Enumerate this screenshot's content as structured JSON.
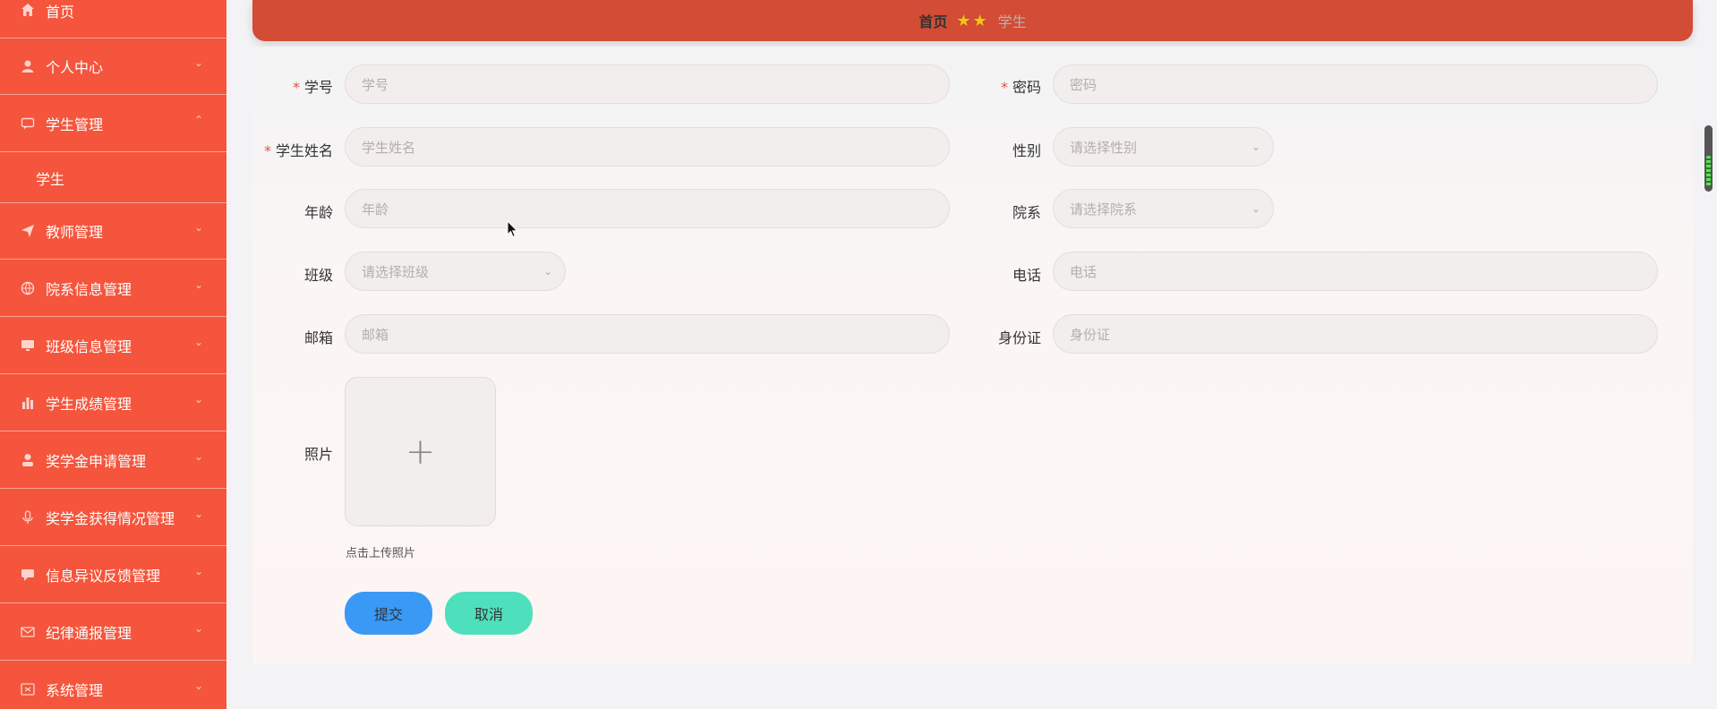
{
  "sidebar": {
    "home": "首页",
    "personal": "个人中心",
    "student_mgmt": "学生管理",
    "student_sub": "学生",
    "teacher_mgmt": "教师管理",
    "dept_mgmt": "院系信息管理",
    "class_mgmt": "班级信息管理",
    "score_mgmt": "学生成绩管理",
    "scholarship_apply": "奖学金申请管理",
    "scholarship_award": "奖学金获得情况管理",
    "feedback": "信息异议反馈管理",
    "discipline": "纪律通报管理",
    "system": "系统管理"
  },
  "breadcrumb": {
    "home": "首页",
    "stars": "★★",
    "current": "学生"
  },
  "form": {
    "student_no_label": "学号",
    "student_no_placeholder": "学号",
    "password_label": "密码",
    "password_placeholder": "密码",
    "name_label": "学生姓名",
    "name_placeholder": "学生姓名",
    "gender_label": "性别",
    "gender_placeholder": "请选择性别",
    "age_label": "年龄",
    "age_placeholder": "年龄",
    "dept_label": "院系",
    "dept_placeholder": "请选择院系",
    "class_label": "班级",
    "class_placeholder": "请选择班级",
    "phone_label": "电话",
    "phone_placeholder": "电话",
    "email_label": "邮箱",
    "email_placeholder": "邮箱",
    "idcard_label": "身份证",
    "idcard_placeholder": "身份证",
    "photo_label": "照片",
    "upload_symbol": "+",
    "upload_hint": "点击上传照片",
    "required_mark": "*",
    "submit": "提交",
    "cancel": "取消"
  },
  "colors": {
    "sidebar_bg": "#f4553c",
    "breadcrumb_bg": "#d34c35",
    "submit_bg": "#3a99f5",
    "cancel_bg": "#4ee0bd"
  }
}
